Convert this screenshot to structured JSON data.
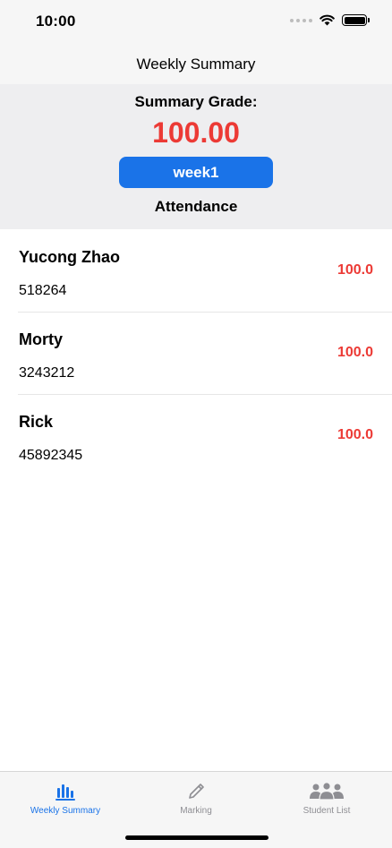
{
  "status_bar": {
    "time": "10:00"
  },
  "nav": {
    "title": "Weekly Summary"
  },
  "summary": {
    "label": "Summary Grade:",
    "grade": "100.00",
    "week_button": "week1",
    "caption": "Attendance"
  },
  "students": [
    {
      "name": "Yucong Zhao",
      "id": "518264",
      "score": "100.0"
    },
    {
      "name": "Morty",
      "id": "3243212",
      "score": "100.0"
    },
    {
      "name": "Rick",
      "id": "45892345",
      "score": "100.0"
    }
  ],
  "tabs": [
    {
      "label": "Weekly Summary",
      "icon": "chart-bar-icon",
      "active": true
    },
    {
      "label": "Marking",
      "icon": "pencil-icon",
      "active": false
    },
    {
      "label": "Student List",
      "icon": "people-icon",
      "active": false
    }
  ],
  "colors": {
    "accent": "#1a73e8",
    "grade": "#ec3a35",
    "inactive": "#8e8e93"
  }
}
